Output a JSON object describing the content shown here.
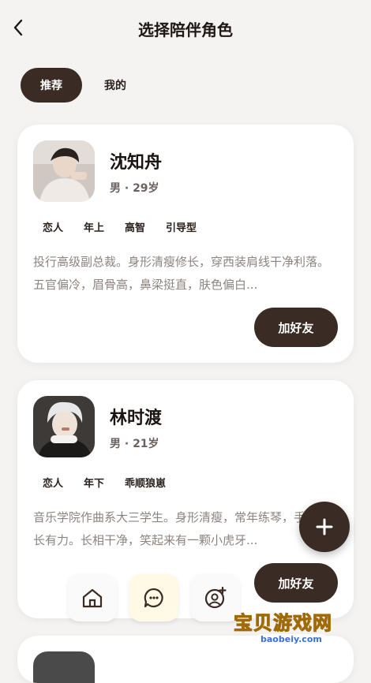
{
  "header": {
    "title": "选择陪伴角色"
  },
  "tabs": [
    {
      "label": "推荐"
    },
    {
      "label": "我的"
    }
  ],
  "cards": [
    {
      "name": "沈知舟",
      "meta": "男 · 29岁",
      "tags": [
        "恋人",
        "年上",
        "高智",
        "引导型"
      ],
      "description": "投行高级副总裁。身形清瘦修长，穿西装肩线干净利落。五官偏冷，眉骨高，鼻梁挺直，肤色偏白...",
      "button_label": "加好友"
    },
    {
      "name": "林时渡",
      "meta": "男 · 21岁",
      "tags": [
        "恋人",
        "年下",
        "乖顺狼崽"
      ],
      "description": "音乐学院作曲系大三学生。身形清瘦，常年练琴，手指修长有力。长相干净，笑起来有一颗小虎牙...",
      "button_label": "加好友"
    }
  ],
  "watermark": {
    "text": "宝贝游戏网",
    "url": "baobeiy.com"
  },
  "colors": {
    "primary": "#3a2b25",
    "accent": "#f3b318",
    "background": "#f4f3f2"
  },
  "icons": {
    "back": "chevron-left-icon",
    "fab": "plus-icon",
    "nav": [
      "home-icon",
      "chat-icon",
      "add-contact-icon"
    ]
  }
}
